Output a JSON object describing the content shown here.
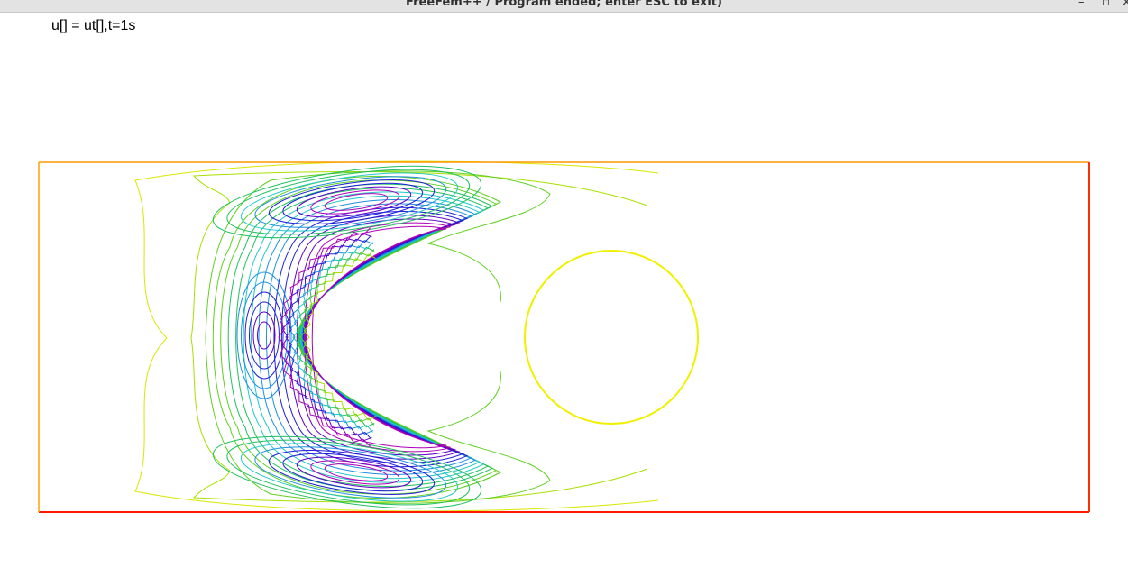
{
  "window": {
    "title": "FreeFem++ / Program ended; enter ESC to exit)",
    "controls": {
      "minimize": "–",
      "maximize": "▫",
      "close": "×"
    }
  },
  "plot": {
    "label": "u[] = ut[],t=1s",
    "colors": {
      "frame_top": "#ff9800",
      "frame_bottom": "#ff1a00",
      "frame_left": "#ffa000",
      "frame_right": "#ff3000",
      "circle": "#f0f000",
      "contour_palette": [
        "#d8e800",
        "#a8e000",
        "#60d020",
        "#20c060",
        "#20c8c8",
        "#1e90e0",
        "#2020d8",
        "#6000c8",
        "#b000b8"
      ]
    }
  }
}
